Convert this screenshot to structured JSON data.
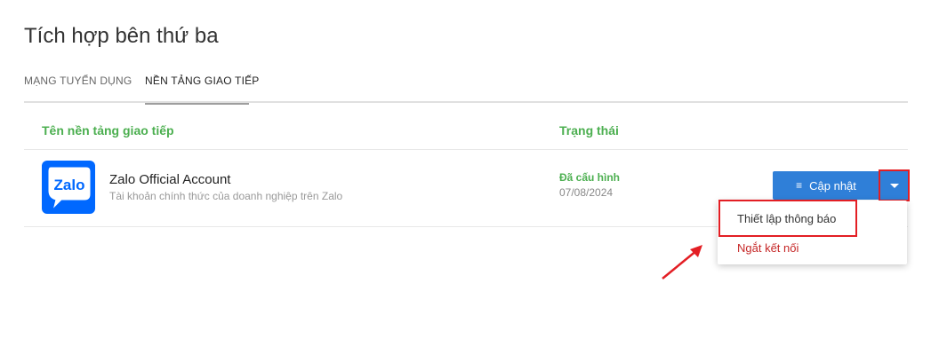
{
  "page": {
    "title": "Tích hợp bên thứ ba"
  },
  "tabs": [
    {
      "label": "MẠNG TUYỂN DỤNG",
      "active": false
    },
    {
      "label": "NỀN TẢNG GIAO TIẾP",
      "active": true
    }
  ],
  "table": {
    "columns": {
      "name": "Tên nền tảng giao tiếp",
      "status": "Trạng thái"
    },
    "rows": [
      {
        "logo_text": "Zalo",
        "name": "Zalo Official Account",
        "description": "Tài khoản chính thức của doanh nghiệp trên Zalo",
        "status": "Đã cấu hình",
        "date": "07/08/2024"
      }
    ]
  },
  "actions": {
    "update_label": "Cập nhật",
    "menu_icon": "≡",
    "dropdown_icon": "chevron-down-icon"
  },
  "dropdown": {
    "items": [
      {
        "label": "Thiết lập thông báo"
      },
      {
        "label": "Ngắt kết nối"
      }
    ]
  },
  "colors": {
    "accent_green": "#4caf50",
    "button_blue": "#2f7fd8",
    "highlight_red": "#e31e24",
    "danger_text": "#c62828",
    "zalo_blue": "#0068ff"
  }
}
